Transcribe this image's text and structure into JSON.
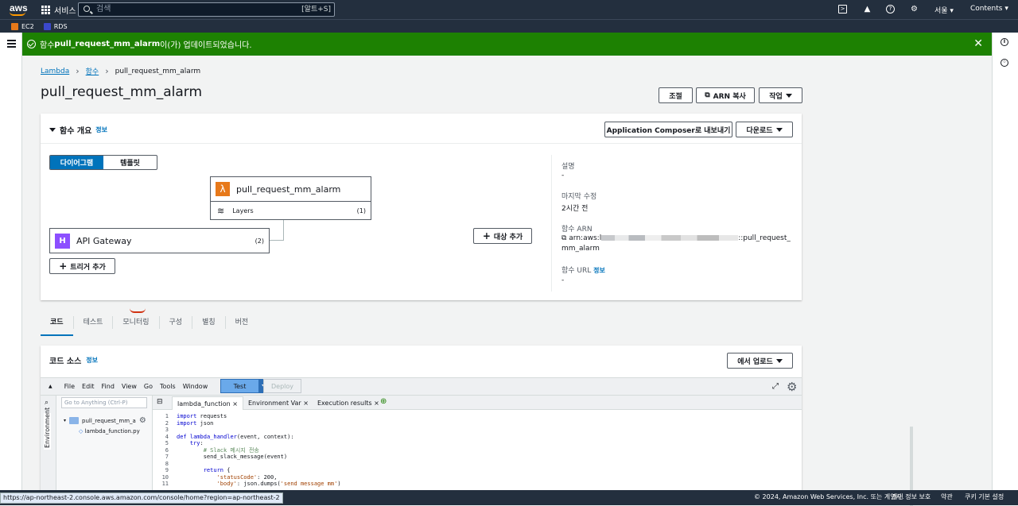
{
  "topbar": {
    "logo": "aws",
    "services": "서비스",
    "search_placeholder": "검색",
    "search_shortcut": "[알트+S]",
    "region": "서울 ▾",
    "contents": "Contents ▾"
  },
  "favorites": [
    {
      "label": "EC2",
      "color": "#e7791a"
    },
    {
      "label": "RDS",
      "color": "#3b48cc"
    }
  ],
  "flash": {
    "prefix": "함수 ",
    "fn": "pull_request_mm_alarm",
    "suffix": "이(가) 업데이트되었습니다."
  },
  "breadcrumb": {
    "root": "Lambda",
    "functions": "함수",
    "current": "pull_request_mm_alarm"
  },
  "page_title": "pull_request_mm_alarm",
  "header_actions": {
    "throttle": "조절",
    "copy_arn": "ARN 복사",
    "actions": "작업"
  },
  "overview": {
    "title": "함수 개요",
    "info": "정보",
    "export": "Application Composer로 내보내기",
    "download": "다운로드",
    "seg_diagram": "다이어그램",
    "seg_template": "템플릿",
    "function_name": "pull_request_mm_alarm",
    "layers_label": "Layers",
    "layers_count": "(1)",
    "trigger_name": "API Gateway",
    "trigger_count": "(2)",
    "add_trigger": "트리거 추가",
    "add_destination": "대상 추가",
    "desc_label": "설명",
    "desc_value": "-",
    "modified_label": "마지막 수정",
    "modified_value": "2시간 전",
    "arn_label": "함수 ARN",
    "arn_prefix": "arn:aws:l",
    "arn_suffix": "::pull_request_",
    "arn_line2": "mm_alarm",
    "url_label": "함수 URL",
    "url_info": "정보",
    "url_value": "-"
  },
  "tabs": [
    "코드",
    "테스트",
    "모니터링",
    "구성",
    "별칭",
    "버전"
  ],
  "code_source": {
    "title": "코드 소스",
    "info": "정보",
    "upload": "에서 업로드",
    "menu": [
      "File",
      "Edit",
      "Find",
      "View",
      "Go",
      "Tools",
      "Window"
    ],
    "test": "Test",
    "deploy": "Deploy",
    "goto_placeholder": "Go to Anything (Ctrl-P)",
    "environment": "Environment",
    "folder": "pull_request_mm_a",
    "file": "lambda_function.py",
    "editor_tabs": [
      "lambda_function",
      "Environment Var",
      "Execution results"
    ],
    "lines": [
      "1",
      "2",
      "3",
      "4",
      "5",
      "6",
      "7",
      "8",
      "9",
      "10",
      "11"
    ]
  },
  "footer": {
    "status_url": "https://ap-northeast-2.console.aws.amazon.com/console/home?region=ap-northeast-2",
    "copyright": "© 2024, Amazon Web Services, Inc. 또는 계열사.",
    "privacy": "개인 정보 보호",
    "terms": "약관",
    "cookies": "쿠키 기본 설정"
  },
  "colors": {
    "success": "#1d8102",
    "link": "#0073bb",
    "nav": "#232f3e",
    "lambda": "#e7791a",
    "apigw": "#8c4fff"
  }
}
